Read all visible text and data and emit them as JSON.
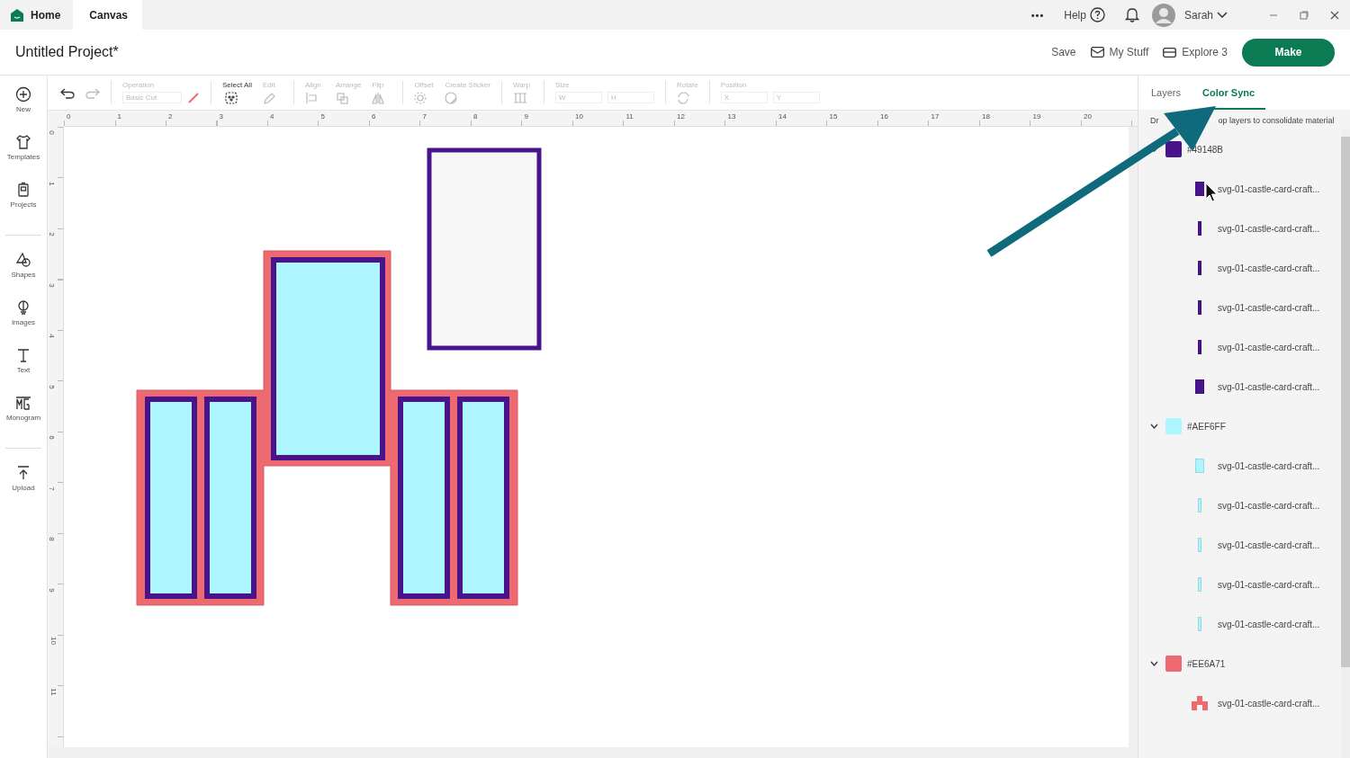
{
  "top_bar": {
    "tabs": [
      {
        "label": "Home",
        "kind": "home",
        "selected": false
      },
      {
        "label": "Canvas",
        "kind": "plain",
        "selected": true
      }
    ],
    "more": "•••",
    "help": "Help",
    "user": "Sarah"
  },
  "header": {
    "title": "Untitled Project*",
    "save": "Save",
    "my_stuff": "My Stuff",
    "machine": "Explore 3",
    "make": "Make"
  },
  "sidebar": {
    "sections": [
      [
        {
          "label": "New",
          "kind": "new"
        },
        {
          "label": "Templates",
          "kind": "templates"
        },
        {
          "label": "Projects",
          "kind": "projects"
        }
      ],
      [
        {
          "label": "Shapes",
          "kind": "shapes"
        },
        {
          "label": "Images",
          "kind": "images"
        },
        {
          "label": "Text",
          "kind": "text"
        },
        {
          "label": "Monogram",
          "kind": "monogram"
        }
      ],
      [
        {
          "label": "Upload",
          "kind": "upload"
        }
      ]
    ]
  },
  "toolbar": {
    "tools": [
      {
        "label": "Operation",
        "kind": "operation",
        "value": "Basic Cut",
        "disabled": true
      },
      {
        "label": "Select All",
        "kind": "select_all",
        "disabled": false
      },
      {
        "label": "Edit",
        "kind": "edit",
        "disabled": true
      },
      {
        "label": "Align",
        "kind": "align",
        "disabled": true
      },
      {
        "label": "Arrange",
        "kind": "arrange",
        "disabled": true
      },
      {
        "label": "Flip",
        "kind": "flip",
        "disabled": true
      },
      {
        "label": "Offset",
        "kind": "offset",
        "disabled": true
      },
      {
        "label": "Create Sticker",
        "kind": "sticker",
        "disabled": true
      },
      {
        "label": "Warp",
        "kind": "warp",
        "disabled": true
      },
      {
        "label": "Size",
        "kind": "size",
        "fields": [
          "W",
          "H"
        ],
        "disabled": true
      },
      {
        "label": "Rotate",
        "kind": "rotate",
        "disabled": true
      },
      {
        "label": "Position",
        "kind": "position",
        "fields": [
          "X",
          "Y"
        ],
        "disabled": true
      }
    ]
  },
  "rulers": {
    "horizontal": [
      "0",
      "1",
      "2",
      "3",
      "4",
      "5",
      "6",
      "7",
      "8",
      "9",
      "10",
      "11",
      "12",
      "13",
      "14",
      "15",
      "16",
      "17",
      "18",
      "19",
      "20"
    ],
    "vertical": [
      "0",
      "1",
      "2",
      "3",
      "4",
      "5",
      "6",
      "7",
      "8",
      "9",
      "10",
      "11"
    ]
  },
  "panel": {
    "tabs": [
      {
        "label": "Layers",
        "selected": false
      },
      {
        "label": "Color Sync",
        "selected": true
      }
    ],
    "hint_parts": [
      "Dr",
      "op layers to consolidate material"
    ],
    "groups": [
      {
        "name": "#49148B",
        "color": "#49148b",
        "expanded": true,
        "items": [
          {
            "name": "svg-01-castle-card-craft...",
            "kind": "rect"
          },
          {
            "name": "svg-01-castle-card-craft...",
            "kind": "strip"
          },
          {
            "name": "svg-01-castle-card-craft...",
            "kind": "strip"
          },
          {
            "name": "svg-01-castle-card-craft...",
            "kind": "strip"
          },
          {
            "name": "svg-01-castle-card-craft...",
            "kind": "strip"
          },
          {
            "name": "svg-01-castle-card-craft...",
            "kind": "rect"
          }
        ]
      },
      {
        "name": "#AEF6FF",
        "color": "#aef6ff",
        "expanded": true,
        "items": [
          {
            "name": "svg-01-castle-card-craft...",
            "kind": "rect"
          },
          {
            "name": "svg-01-castle-card-craft...",
            "kind": "strip"
          },
          {
            "name": "svg-01-castle-card-craft...",
            "kind": "strip"
          },
          {
            "name": "svg-01-castle-card-craft...",
            "kind": "strip"
          },
          {
            "name": "svg-01-castle-card-craft...",
            "kind": "strip"
          }
        ]
      },
      {
        "name": "#EE6A71",
        "color": "#ee6a71",
        "expanded": true,
        "items": [
          {
            "name": "svg-01-castle-card-craft...",
            "kind": "castle"
          }
        ]
      }
    ]
  }
}
